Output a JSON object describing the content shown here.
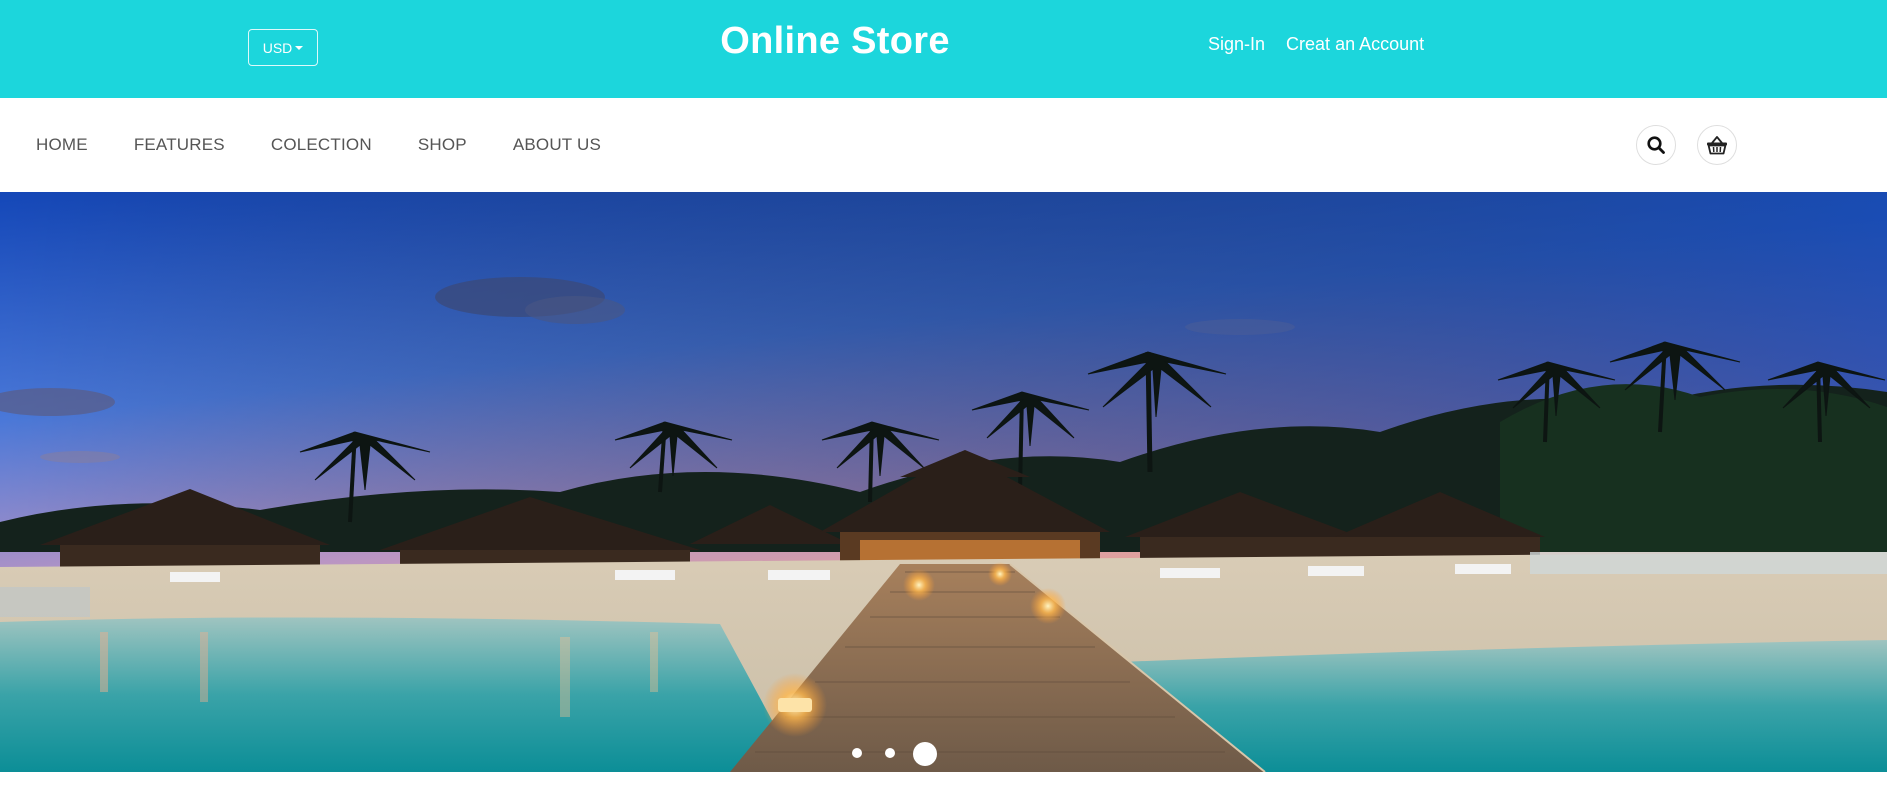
{
  "header": {
    "currency_label": "USD",
    "store_title": "Online Store",
    "sign_in": "Sign-In",
    "create_account": "Creat an Account",
    "brand_color": "#1cd6dc"
  },
  "nav": {
    "items": [
      "HOME",
      "FEATURES",
      "COLECTION",
      "SHOP",
      "ABOUT US"
    ],
    "icons": [
      "search-icon",
      "basket-icon"
    ]
  },
  "hero": {
    "image": "tropical-resort-beach-sunset",
    "slides_total": 3,
    "active_slide": 3
  }
}
